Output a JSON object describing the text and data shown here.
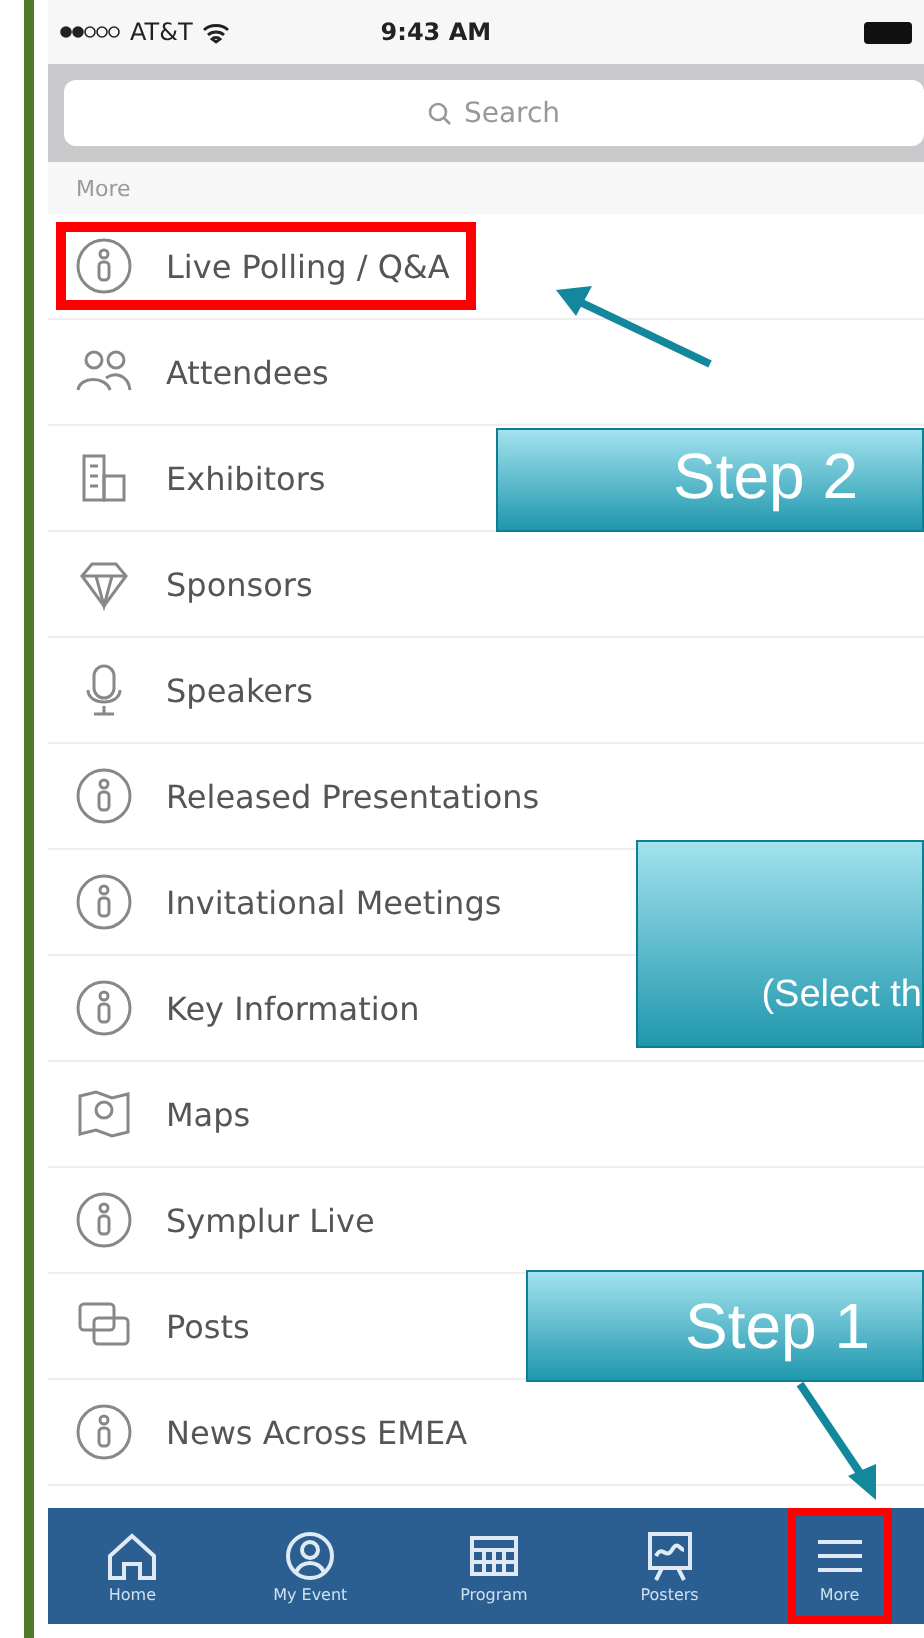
{
  "status_bar": {
    "carrier": "AT&T",
    "time": "9:43 AM"
  },
  "search": {
    "placeholder": "Search"
  },
  "section_header": "More",
  "items": [
    {
      "label": "Live Polling / Q&A",
      "kind": "info",
      "highlighted": true
    },
    {
      "label": "Attendees",
      "kind": "people",
      "highlighted": false
    },
    {
      "label": "Exhibitors",
      "kind": "building",
      "highlighted": false
    },
    {
      "label": "Sponsors",
      "kind": "diamond",
      "highlighted": false
    },
    {
      "label": "Speakers",
      "kind": "mic",
      "highlighted": false
    },
    {
      "label": "Released Presentations",
      "kind": "info",
      "highlighted": false
    },
    {
      "label": "Invitational Meetings",
      "kind": "info",
      "highlighted": false
    },
    {
      "label": "Key Information",
      "kind": "info",
      "highlighted": false
    },
    {
      "label": "Maps",
      "kind": "map",
      "highlighted": false
    },
    {
      "label": "Symplur Live",
      "kind": "info",
      "highlighted": false
    },
    {
      "label": "Posts",
      "kind": "chat",
      "highlighted": false
    },
    {
      "label": "News Across EMEA",
      "kind": "info",
      "highlighted": false
    }
  ],
  "tab_bar": [
    {
      "label": "Home",
      "kind": "home",
      "highlighted": false
    },
    {
      "label": "My Event",
      "kind": "person",
      "highlighted": false
    },
    {
      "label": "Program",
      "kind": "calendar",
      "highlighted": false
    },
    {
      "label": "Posters",
      "kind": "easel",
      "highlighted": false
    },
    {
      "label": "More",
      "kind": "menu",
      "highlighted": true
    }
  ],
  "callouts": [
    {
      "text": "Step 2"
    },
    {
      "text": "(Select th"
    },
    {
      "text": "Step 1"
    }
  ]
}
